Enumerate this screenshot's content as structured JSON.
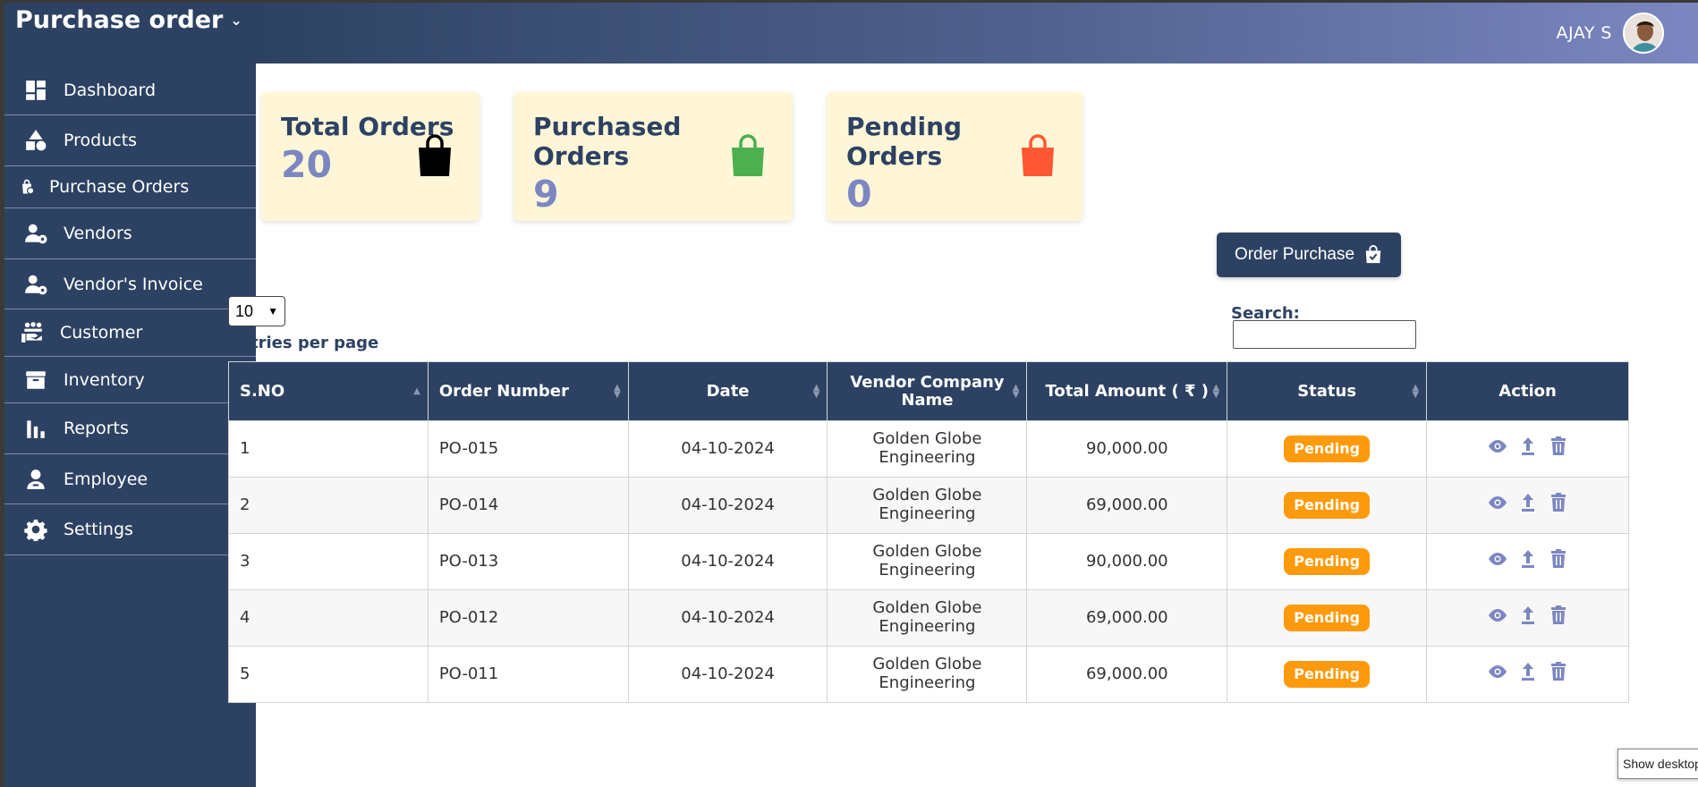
{
  "app": {
    "title": "Purchase order"
  },
  "sidebar": {
    "items": [
      {
        "label": "Dashboard",
        "icon": "dashboard-icon"
      },
      {
        "label": "Products",
        "icon": "shapes-icon"
      },
      {
        "label": "Purchase Orders",
        "icon": "purchase-orders-icon"
      },
      {
        "label": "Vendors",
        "icon": "vendor-gear-icon"
      },
      {
        "label": "Vendor's Invoice",
        "icon": "vendor-invoice-icon"
      },
      {
        "label": "Customer",
        "icon": "customer-hand-icon"
      },
      {
        "label": "Inventory",
        "icon": "archive-box-icon"
      },
      {
        "label": "Reports",
        "icon": "bar-chart-icon"
      },
      {
        "label": "Employee",
        "icon": "employee-icon"
      },
      {
        "label": "Settings",
        "icon": "gear-icon"
      }
    ]
  },
  "header": {
    "user_name": "AJAY S"
  },
  "stats": [
    {
      "title": "Total Orders",
      "value": "20",
      "color": "#000000"
    },
    {
      "title": "Purchased Orders",
      "value": "9",
      "color": "#4caf50"
    },
    {
      "title": "Pending Orders",
      "value": "0",
      "color": "#ff5733"
    }
  ],
  "order_button": {
    "label": "Order Purchase"
  },
  "table_controls": {
    "page_length": "10",
    "entries_label": "entries per page",
    "search_label": "Search:",
    "search_value": ""
  },
  "table": {
    "headers": [
      "S.NO",
      "Order Number",
      "Date",
      "Vendor Company Name",
      "Total Amount ( ₹ )",
      "Status",
      "Action"
    ],
    "rows": [
      {
        "sno": "1",
        "order": "PO-015",
        "date": "04-10-2024",
        "vendor": "Golden Globe Engineering",
        "amount": "90,000.00",
        "status": "Pending"
      },
      {
        "sno": "2",
        "order": "PO-014",
        "date": "04-10-2024",
        "vendor": "Golden Globe Engineering",
        "amount": "69,000.00",
        "status": "Pending"
      },
      {
        "sno": "3",
        "order": "PO-013",
        "date": "04-10-2024",
        "vendor": "Golden Globe Engineering",
        "amount": "90,000.00",
        "status": "Pending"
      },
      {
        "sno": "4",
        "order": "PO-012",
        "date": "04-10-2024",
        "vendor": "Golden Globe Engineering",
        "amount": "69,000.00",
        "status": "Pending"
      },
      {
        "sno": "5",
        "order": "PO-011",
        "date": "04-10-2024",
        "vendor": "Golden Globe Engineering",
        "amount": "69,000.00",
        "status": "Pending"
      }
    ]
  },
  "tooltip": {
    "text": "Show desktop"
  },
  "colors": {
    "primary": "#2d4262",
    "accent": "#7c87c1",
    "card_bg": "#fff6d8",
    "badge": "#ff9a0c"
  }
}
